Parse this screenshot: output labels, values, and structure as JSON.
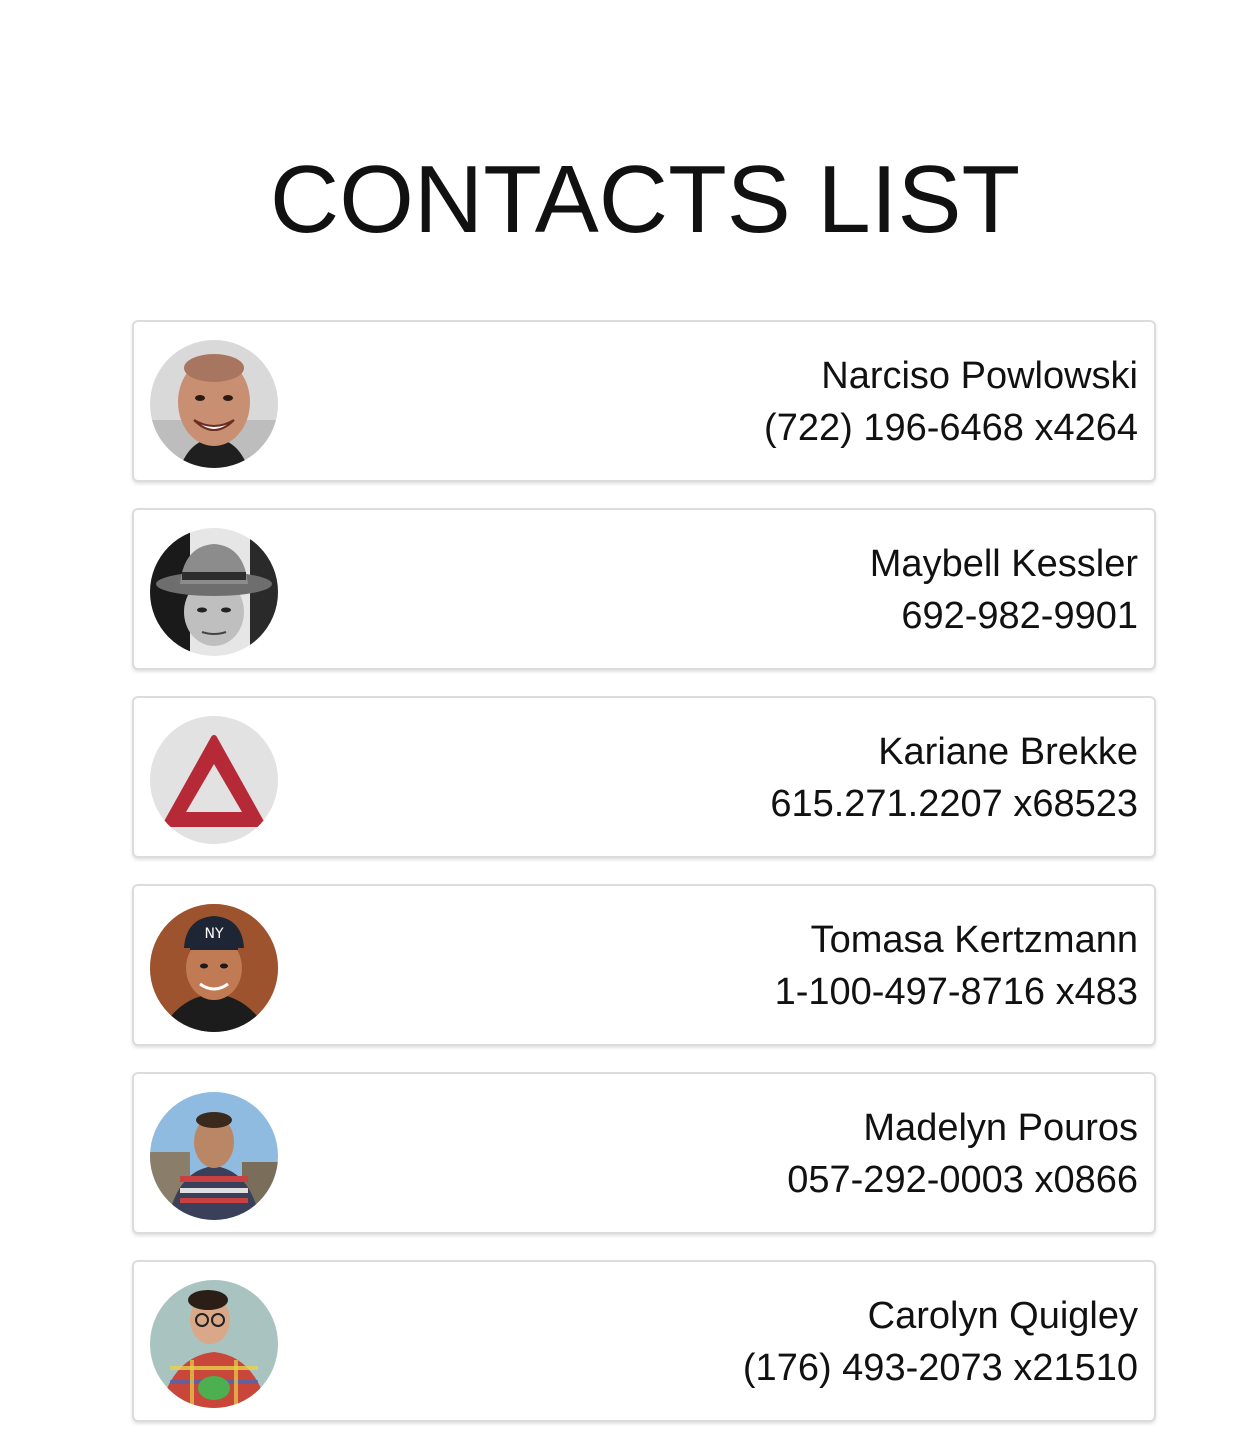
{
  "header": {
    "title": "CONTACTS LIST"
  },
  "contacts": [
    {
      "name": "Narciso Powlowski",
      "phone": "(722) 196-6468 x4264",
      "avatar": "photo-smiling-man"
    },
    {
      "name": "Maybell Kessler",
      "phone": "692-982-9901",
      "avatar": "photo-man-in-hat-bw"
    },
    {
      "name": "Kariane Brekke",
      "phone": "615.271.2207 x68523",
      "avatar": "red-triangle-icon"
    },
    {
      "name": "Tomasa Kertzmann",
      "phone": "1-100-497-8716 x483",
      "avatar": "photo-man-in-cap"
    },
    {
      "name": "Madelyn Pouros",
      "phone": "057-292-0003 x0866",
      "avatar": "photo-man-striped-shirt"
    },
    {
      "name": "Carolyn Quigley",
      "phone": "(176) 493-2073 x21510",
      "avatar": "photo-man-plaid-shirt"
    }
  ]
}
